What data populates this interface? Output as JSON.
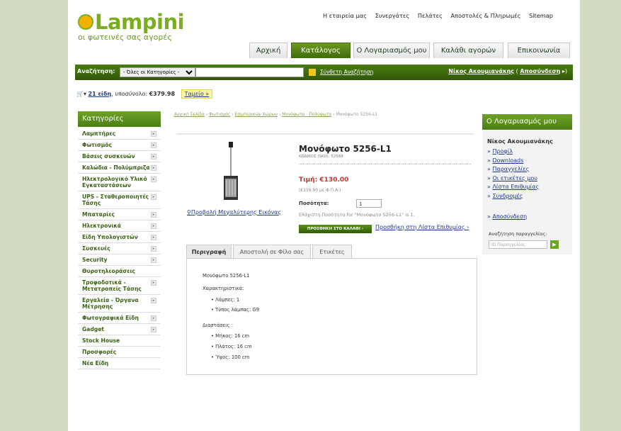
{
  "brand": {
    "logo_text": "Lampini",
    "tagline": "οι φωτεινές σας αγορές",
    "accent": "#7aae1c"
  },
  "top_links": [
    "Η εταιρεία μας",
    "Συνεργάτες",
    "Πελάτες",
    "Αποστολές & Πληρωμές",
    "Sitemap"
  ],
  "main_nav": [
    {
      "label": "Αρχική",
      "active": false
    },
    {
      "label": "Κατάλογος",
      "active": true
    },
    {
      "label": "Ο Λογαριασμός μου",
      "active": false
    },
    {
      "label": "Καλάθι αγορών",
      "active": false
    },
    {
      "label": "Επικοινωνία",
      "active": false
    }
  ],
  "search": {
    "label": "Αναζήτηση:",
    "category_selected": "- Όλες οι Κατηγορίες -",
    "query": "",
    "advanced": "Σύνθετη Αναζήτηση"
  },
  "user": {
    "name": "Νίκος Ακουμιανάκης",
    "logout": "Αποσύνδεση"
  },
  "cart": {
    "items": "21 είδη",
    "subtotal_label": "υποσύνολο:",
    "subtotal": "€379.98",
    "checkout": "Ταμείο »"
  },
  "categories": {
    "title": "Κατηγορίες",
    "items": [
      {
        "label": "Λαμπτήρες",
        "arrow": true
      },
      {
        "label": "Φωτισμός",
        "arrow": true
      },
      {
        "label": "Βάσεις συσκευών",
        "arrow": true
      },
      {
        "label": "Καλώδια - Πολύμπριζα",
        "arrow": true
      },
      {
        "label": "Ηλεκτρολογικό Υλικό Εγκαταστάσεων",
        "arrow": true
      },
      {
        "label": "UPS - Σταθεροποιητές Τάσης",
        "arrow": true
      },
      {
        "label": "Μπαταρίες",
        "arrow": true
      },
      {
        "label": "Ηλεκτρονικά",
        "arrow": true
      },
      {
        "label": "Είδη Υπολογιστών",
        "arrow": true
      },
      {
        "label": "Συσκευές",
        "arrow": true
      },
      {
        "label": "Security",
        "arrow": true
      },
      {
        "label": "Θυροτηλεοράσεις",
        "arrow": false
      },
      {
        "label": "Τροφοδοτικά - Μετατροπείς Τάσης",
        "arrow": true
      },
      {
        "label": "Εργαλεία - Όργανα Μέτρησης",
        "arrow": true
      },
      {
        "label": "Φωτογραφικά Είδη",
        "arrow": true
      },
      {
        "label": "Gadget",
        "arrow": true
      },
      {
        "label": "Stock House",
        "arrow": false
      },
      {
        "label": "Προσφορές",
        "arrow": false
      },
      {
        "label": "Νέα Είδη",
        "arrow": false
      }
    ]
  },
  "breadcrumb": [
    "Αρχική Σελίδα",
    "Φωτισμός",
    "Εσωτερικών Χώρων",
    "Μονόφωτα - Πολύφωτα",
    "Μονόφωτο 5256-L1"
  ],
  "product": {
    "title": "Μονόφωτο 5256-L1",
    "sku": "ΚΩΔΙΚΟΣ (SKU): 52568",
    "price": "Τιμή: €130.00",
    "price_vat": "(€159.90 με Φ.Π.Α.)",
    "qty_label": "Ποσότητα:",
    "qty": "1",
    "min_qty": "Ελάχιστη Ποσότητα for \"Μονόφωτο 5256-L1\" is 1.",
    "add_to_cart": "ΠΡΟΣΘΗΚΗ ΣΤΟ ΚΑΛΑΘΙ ›",
    "add_to_wishlist": "Προσθήκη στη Λίστα Επιθυμίας ›",
    "enlarge": "Προβολή Μεγαλύτερης Εικόνας"
  },
  "tabs": [
    "Περιγραφή",
    "Αποστολή σε Φίλο σας",
    "Ετικέτες"
  ],
  "description": {
    "name": "Μονόφωτο 5256-L1",
    "features_title": "Χαρακτηριστικά:",
    "features": [
      "Λάμπες: 1",
      "Τύπος λάμπας: G9"
    ],
    "dims_title": "Διαστάσεις :",
    "dims": [
      "Μήκος: 16 cm",
      "Πλάτος: 16 cm",
      "Ύψος: 100 cm"
    ]
  },
  "account": {
    "title": "Ο Λογαριασμός μου",
    "name": "Νίκος Ακουμιανάκης",
    "links": [
      "Προφίλ",
      "Downloads",
      "Παραγγελίες",
      "Οι ετικέτες μου",
      "Λίστα Επιθυμίας",
      "Συνδρομές"
    ],
    "logout": "Αποσύνδεση",
    "order_search_label": "Αναζήτηση παραγγελίας:",
    "order_placeholder": "ID Παραγγελίας"
  }
}
